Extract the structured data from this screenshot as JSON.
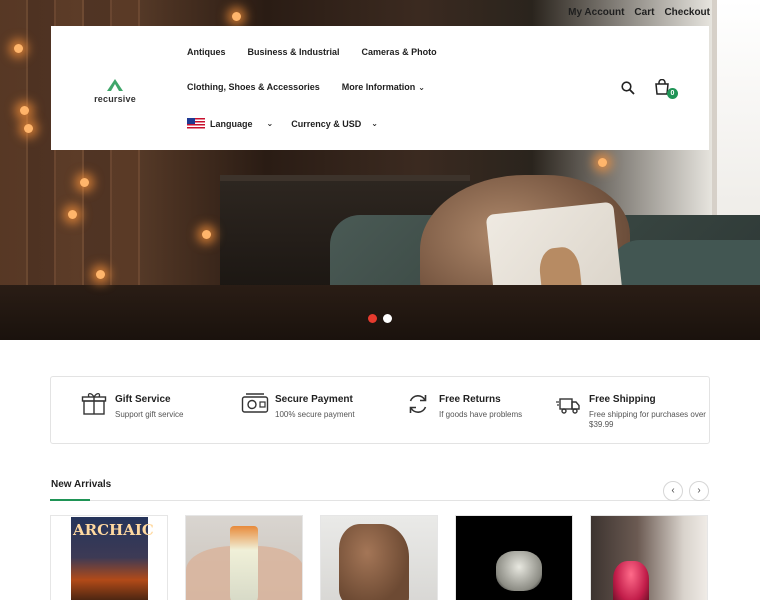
{
  "top_links": {
    "account": "My Account",
    "cart": "Cart",
    "checkout": "Checkout"
  },
  "logo": {
    "name": "recursive"
  },
  "nav": {
    "row1": [
      "Antiques",
      "Business & Industrial",
      "Cameras & Photo"
    ],
    "row2": [
      "Clothing, Shoes & Accessories",
      "More Information"
    ],
    "language": "Language",
    "currency": "Currency & USD"
  },
  "cart": {
    "count": "0"
  },
  "hero": {
    "slides": 2,
    "active_slide": 1
  },
  "services": [
    {
      "icon": "gift-icon",
      "title": "Gift Service",
      "desc": "Support gift service"
    },
    {
      "icon": "secure-payment-icon",
      "title": "Secure Payment",
      "desc": "100% secure payment"
    },
    {
      "icon": "refresh-icon",
      "title": "Free Returns",
      "desc": "If goods have problems"
    },
    {
      "icon": "truck-icon",
      "title": "Free Shipping",
      "desc": "Free shipping for purchases over $39.99"
    }
  ],
  "arrivals": {
    "title": "New Arrivals",
    "product1_cover_text": "ARCHAIC"
  },
  "colors": {
    "accent": "#1f9456",
    "slide_active": "#e63b2e"
  }
}
